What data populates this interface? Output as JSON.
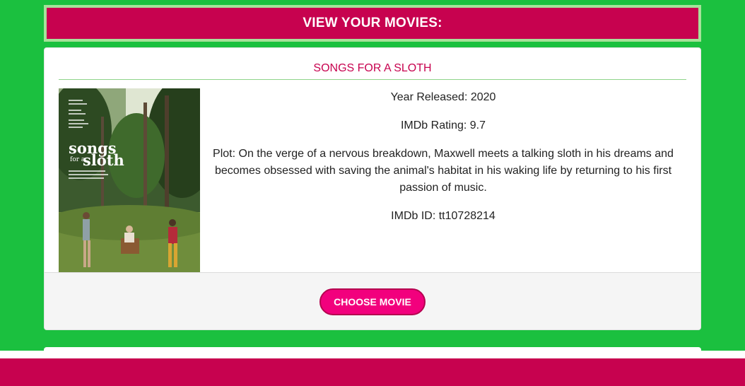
{
  "header": {
    "title": "VIEW YOUR MOVIES:"
  },
  "movie": {
    "title": "SONGS FOR A SLOTH",
    "year": "Year Released: 2020",
    "rating": "IMDb Rating: 9.7",
    "plot": "Plot: On the verge of a nervous breakdown, Maxwell meets a talking sloth in his dreams and becomes obsessed with saving the animal's habitat in his waking life by returning to his first passion of music.",
    "imdb_id": "IMDb ID: tt10728214",
    "poster": {
      "title_line1": "songs",
      "title_line2": "for a",
      "title_line3": "sloth"
    }
  },
  "actions": {
    "choose_label": "CHOOSE MOVIE"
  },
  "colors": {
    "accent": "#c7024f",
    "button": "#f2007d",
    "background": "#1bc03f"
  }
}
